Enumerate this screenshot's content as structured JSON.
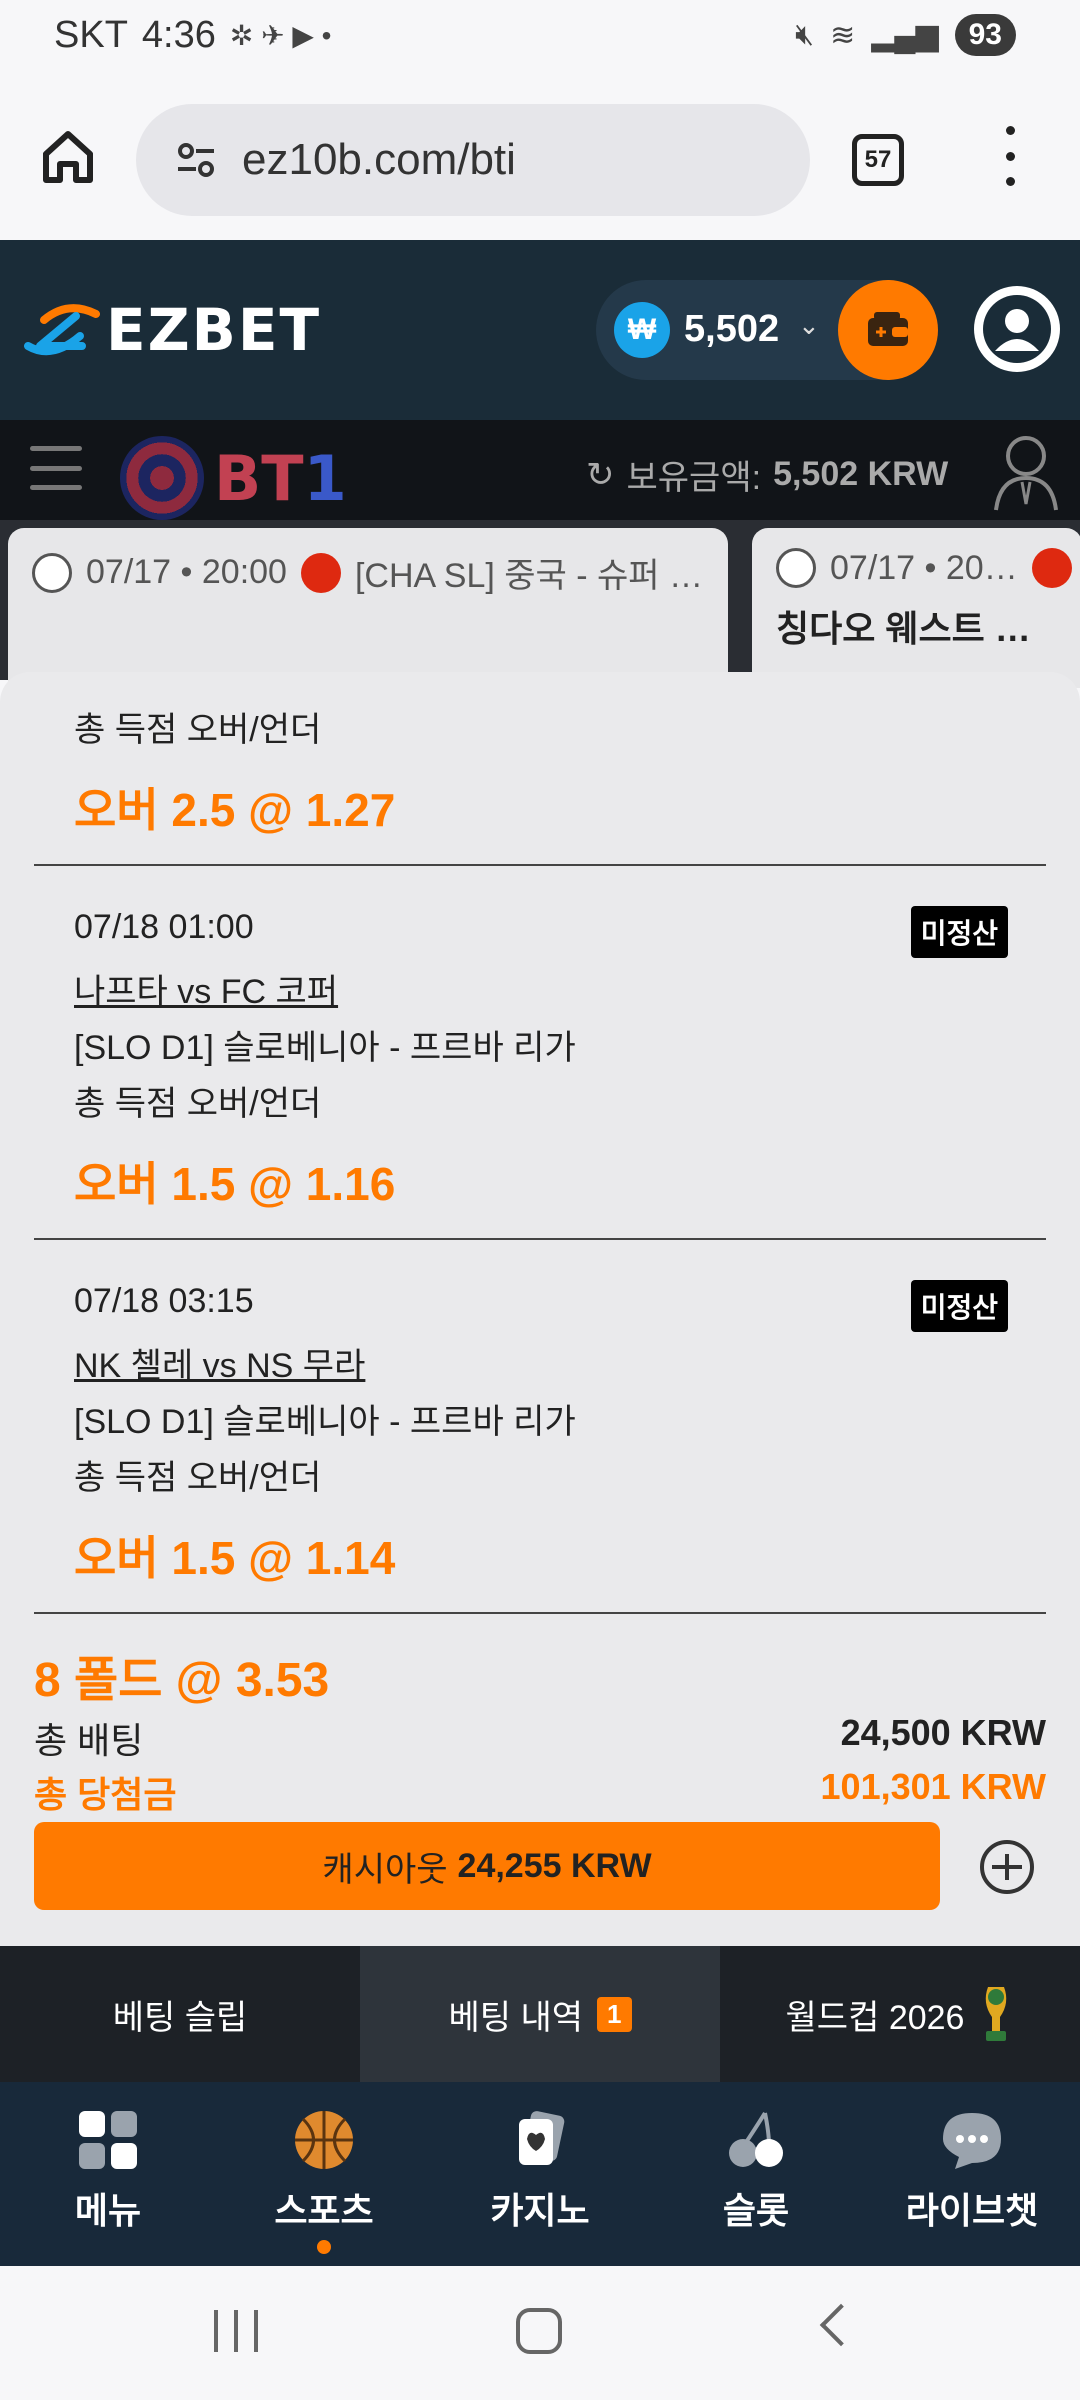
{
  "status": {
    "carrier": "SKT",
    "time": "4:36",
    "battery": "93"
  },
  "browser": {
    "url": "ez10b.com/bti",
    "tab_count": "57"
  },
  "header": {
    "logo": "EZBET",
    "currency_symbol": "₩",
    "balance": "5,502",
    "accent": "#ff7a00"
  },
  "bti": {
    "logo_a": "BT",
    "logo_b": "1",
    "balance_label": "보유금액:",
    "balance_value": "5,502 KRW"
  },
  "background_cards": [
    {
      "datetime": "07/17 • 20:00",
      "league": "[CHA SL] 중국 - 슈퍼 …"
    },
    {
      "datetime": "07/17 • 20…",
      "team": "칭다오 웨스트 …"
    }
  ],
  "bets": [
    {
      "market": "총 득점 오버/언더",
      "odds": "오버 2.5 @ 1.27"
    },
    {
      "date": "07/18 01:00",
      "badge": "미정산",
      "match": "나프타 vs FC 코퍼",
      "league": "[SLO D1] 슬로베니아 - 프르바 리가",
      "market": "총 득점 오버/언더",
      "odds": "오버 1.5 @ 1.16"
    },
    {
      "date": "07/18 03:15",
      "badge": "미정산",
      "match": "NK 첼레 vs NS 무라",
      "league": "[SLO D1] 슬로베니아 - 프르바 리가",
      "market": "총 득점 오버/언더",
      "odds": "오버 1.5 @ 1.14"
    }
  ],
  "summary": {
    "fold": "8 폴드 @ 3.53",
    "total_bet_label": "총 배팅",
    "total_bet_value": "24,500 KRW",
    "total_win_label": "총 당첨금",
    "total_win_value": "101,301 KRW",
    "cashout_label": "캐시아웃",
    "cashout_value": "24,255 KRW"
  },
  "slip_tabs": [
    {
      "label": "베팅 슬립"
    },
    {
      "label": "베팅 내역",
      "badge": "1"
    },
    {
      "label": "월드컵 2026"
    }
  ],
  "nav": [
    {
      "label": "메뉴",
      "icon": "grid-icon"
    },
    {
      "label": "스포츠",
      "icon": "basketball-icon"
    },
    {
      "label": "카지노",
      "icon": "cards-icon"
    },
    {
      "label": "슬롯",
      "icon": "cherry-icon"
    },
    {
      "label": "라이브챗",
      "icon": "chat-icon"
    }
  ]
}
